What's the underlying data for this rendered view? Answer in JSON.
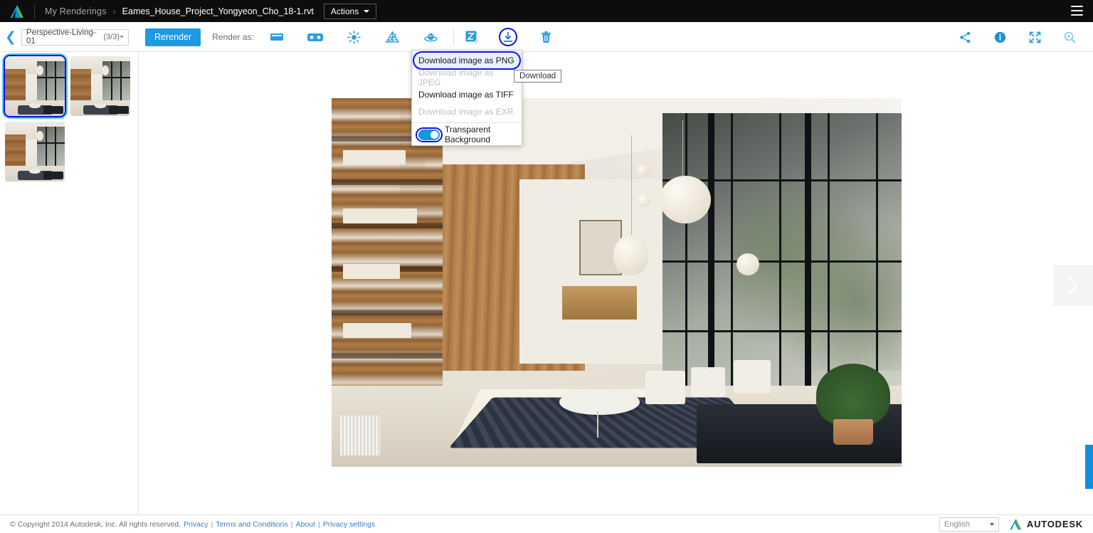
{
  "header": {
    "logo_icon": "autodesk-logo-icon",
    "breadcrumb_root": "My Renderings",
    "breadcrumb_separator": "›",
    "breadcrumb_file": "Eames_House_Project_Yongyeon_Cho_18-1.rvt",
    "actions_label": "Actions",
    "menu_icon": "hamburger-menu-icon"
  },
  "toolbar": {
    "back_icon": "chevron-left-icon",
    "view_name": "Perspective-Living-01",
    "view_count": "(3/3)",
    "rerender_label": "Rerender",
    "render_as_label": "Render as:",
    "render_as_icons": [
      "panorama-icon",
      "stereo-panorama-icon",
      "illuminance-icon",
      "solar-study-icon",
      "360-render-icon"
    ],
    "enhance_icon": "enhance-image-icon",
    "download_icon": "download-icon",
    "delete_icon": "trash-icon",
    "right_icons": [
      "share-icon",
      "info-icon",
      "fullscreen-icon",
      "zoom-in-icon"
    ]
  },
  "download_menu": {
    "items": [
      {
        "label": "Download image as PNG",
        "disabled": false,
        "highlighted": true
      },
      {
        "label": "Download image as JPEG",
        "disabled": true,
        "highlighted": false
      },
      {
        "label": "Download image as TIFF",
        "disabled": false,
        "highlighted": false
      },
      {
        "label": "Download image as EXR",
        "disabled": true,
        "highlighted": false
      }
    ],
    "toggle_label": "Transparent Background",
    "toggle_on": true,
    "tooltip": "Download"
  },
  "sidebar": {
    "thumbnails": [
      {
        "name": "thumbnail-1",
        "selected": true
      },
      {
        "name": "thumbnail-2",
        "selected": false
      },
      {
        "name": "thumbnail-3",
        "selected": false
      }
    ]
  },
  "viewer": {
    "next_icon": "chevron-right-icon",
    "scrollbar": "vertical-scrollbar-thumb"
  },
  "footer": {
    "copyright": "© Copyright 2014 Autodesk, Inc. All rights reserved.",
    "links": [
      "Privacy",
      "Terms and Conditions",
      "About",
      "Privacy settings"
    ],
    "separator": "|",
    "language": "English",
    "brand": "AUTODESK"
  },
  "colors": {
    "accent_blue": "#1e9ae0",
    "highlight_ring": "#1015e8",
    "header_bg": "#0d0d0d",
    "link_blue": "#3b7fc4"
  }
}
